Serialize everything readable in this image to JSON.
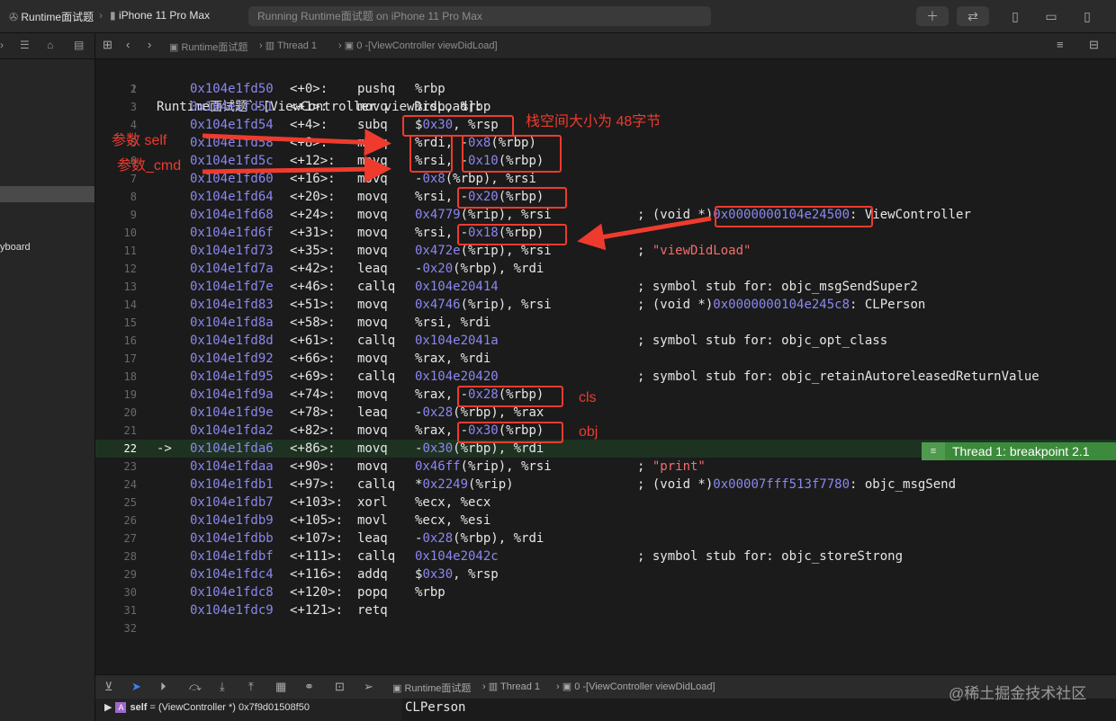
{
  "toolbar": {
    "scheme": "Runtime面试题",
    "device": "iPhone 11 Pro Max",
    "status": "Running Runtime面试题 on iPhone 11 Pro Max",
    "buttons": [
      "plus-icon",
      "swap-icon",
      "left-panel-icon",
      "bottom-panel-icon",
      "right-panel-icon"
    ]
  },
  "navigator": {
    "partial_label": "yboard"
  },
  "jumpbar": {
    "project": "Runtime面试题",
    "thread": "Thread 1",
    "frame": "0 -[ViewController viewDidLoad]"
  },
  "code": {
    "header_line": "1",
    "header": "Runtime面试题`-[ViewController viewDidLoad]:",
    "lines": [
      {
        "n": "2",
        "addr": "0x104e1fd50",
        "off": "<+0>:",
        "mn": "pushq",
        "ops": "%rbp",
        "cmt": ""
      },
      {
        "n": "3",
        "addr": "0x104e1fd51",
        "off": "<+1>:",
        "mn": "movq",
        "ops": "%rsp, %rbp",
        "cmt": ""
      },
      {
        "n": "4",
        "addr": "0x104e1fd54",
        "off": "<+4>:",
        "mn": "subq",
        "ops": "$0x30, %rsp",
        "cmt": ""
      },
      {
        "n": "5",
        "addr": "0x104e1fd58",
        "off": "<+8>:",
        "mn": "movq",
        "ops": "%rdi, -0x8(%rbp)",
        "cmt": ""
      },
      {
        "n": "6",
        "addr": "0x104e1fd5c",
        "off": "<+12>:",
        "mn": "movq",
        "ops": "%rsi, -0x10(%rbp)",
        "cmt": ""
      },
      {
        "n": "7",
        "addr": "0x104e1fd60",
        "off": "<+16>:",
        "mn": "movq",
        "ops": "-0x8(%rbp), %rsi",
        "cmt": ""
      },
      {
        "n": "8",
        "addr": "0x104e1fd64",
        "off": "<+20>:",
        "mn": "movq",
        "ops": "%rsi, -0x20(%rbp)",
        "cmt": ""
      },
      {
        "n": "9",
        "addr": "0x104e1fd68",
        "off": "<+24>:",
        "mn": "movq",
        "ops": "0x4779(%rip), %rsi",
        "cmt": "; (void *)0x0000000104e24500: ViewController"
      },
      {
        "n": "10",
        "addr": "0x104e1fd6f",
        "off": "<+31>:",
        "mn": "movq",
        "ops": "%rsi, -0x18(%rbp)",
        "cmt": ""
      },
      {
        "n": "11",
        "addr": "0x104e1fd73",
        "off": "<+35>:",
        "mn": "movq",
        "ops": "0x472e(%rip), %rsi",
        "cmt": "; \"viewDidLoad\""
      },
      {
        "n": "12",
        "addr": "0x104e1fd7a",
        "off": "<+42>:",
        "mn": "leaq",
        "ops": "-0x20(%rbp), %rdi",
        "cmt": ""
      },
      {
        "n": "13",
        "addr": "0x104e1fd7e",
        "off": "<+46>:",
        "mn": "callq",
        "ops": "0x104e20414",
        "cmt": "; symbol stub for: objc_msgSendSuper2"
      },
      {
        "n": "14",
        "addr": "0x104e1fd83",
        "off": "<+51>:",
        "mn": "movq",
        "ops": "0x4746(%rip), %rsi",
        "cmt": "; (void *)0x0000000104e245c8: CLPerson"
      },
      {
        "n": "15",
        "addr": "0x104e1fd8a",
        "off": "<+58>:",
        "mn": "movq",
        "ops": "%rsi, %rdi",
        "cmt": ""
      },
      {
        "n": "16",
        "addr": "0x104e1fd8d",
        "off": "<+61>:",
        "mn": "callq",
        "ops": "0x104e2041a",
        "cmt": "; symbol stub for: objc_opt_class"
      },
      {
        "n": "17",
        "addr": "0x104e1fd92",
        "off": "<+66>:",
        "mn": "movq",
        "ops": "%rax, %rdi",
        "cmt": ""
      },
      {
        "n": "18",
        "addr": "0x104e1fd95",
        "off": "<+69>:",
        "mn": "callq",
        "ops": "0x104e20420",
        "cmt": "; symbol stub for: objc_retainAutoreleasedReturnValue"
      },
      {
        "n": "19",
        "addr": "0x104e1fd9a",
        "off": "<+74>:",
        "mn": "movq",
        "ops": "%rax, -0x28(%rbp)",
        "cmt": ""
      },
      {
        "n": "20",
        "addr": "0x104e1fd9e",
        "off": "<+78>:",
        "mn": "leaq",
        "ops": "-0x28(%rbp), %rax",
        "cmt": ""
      },
      {
        "n": "21",
        "addr": "0x104e1fda2",
        "off": "<+82>:",
        "mn": "movq",
        "ops": "%rax, -0x30(%rbp)",
        "cmt": ""
      },
      {
        "n": "22",
        "addr": "0x104e1fda6",
        "off": "<+86>:",
        "mn": "movq",
        "ops": "-0x30(%rbp), %rdi",
        "cmt": "",
        "current": true,
        "arrow": "->"
      },
      {
        "n": "23",
        "addr": "0x104e1fdaa",
        "off": "<+90>:",
        "mn": "movq",
        "ops": "0x46ff(%rip), %rsi",
        "cmt": "; \"print\""
      },
      {
        "n": "24",
        "addr": "0x104e1fdb1",
        "off": "<+97>:",
        "mn": "callq",
        "ops": "*0x2249(%rip)",
        "cmt": "; (void *)0x00007fff513f7780: objc_msgSend"
      },
      {
        "n": "25",
        "addr": "0x104e1fdb7",
        "off": "<+103>:",
        "mn": "xorl",
        "ops": "%ecx, %ecx",
        "cmt": ""
      },
      {
        "n": "26",
        "addr": "0x104e1fdb9",
        "off": "<+105>:",
        "mn": "movl",
        "ops": "%ecx, %esi",
        "cmt": ""
      },
      {
        "n": "27",
        "addr": "0x104e1fdbb",
        "off": "<+107>:",
        "mn": "leaq",
        "ops": "-0x28(%rbp), %rdi",
        "cmt": ""
      },
      {
        "n": "28",
        "addr": "0x104e1fdbf",
        "off": "<+111>:",
        "mn": "callq",
        "ops": "0x104e2042c",
        "cmt": "; symbol stub for: objc_storeStrong"
      },
      {
        "n": "29",
        "addr": "0x104e1fdc4",
        "off": "<+116>:",
        "mn": "addq",
        "ops": "$0x30, %rsp",
        "cmt": ""
      },
      {
        "n": "30",
        "addr": "0x104e1fdc8",
        "off": "<+120>:",
        "mn": "popq",
        "ops": "%rbp",
        "cmt": ""
      },
      {
        "n": "31",
        "addr": "0x104e1fdc9",
        "off": "<+121>:",
        "mn": "retq",
        "ops": "",
        "cmt": ""
      },
      {
        "n": "32",
        "addr": "",
        "off": "",
        "mn": "",
        "ops": "",
        "cmt": ""
      }
    ],
    "breakpoint_badge": "Thread 1: breakpoint 2.1"
  },
  "annotations": {
    "stack_size": "栈空间大小为 48字节",
    "param_self": "参数 self",
    "param_cmd": "参数_cmd",
    "cls": "cls",
    "obj": "obj"
  },
  "debugbar": {
    "project": "Runtime面试题",
    "thread": "Thread 1",
    "frame": "0 -[ViewController viewDidLoad]"
  },
  "variables": {
    "row1_name": "self",
    "row1_value": "= (ViewController *) 0x7f9d01508f50"
  },
  "console": {
    "output": "CLPerson"
  },
  "watermark": "@稀土掘金技术社区",
  "colors": {
    "annotation": "#ee3b2e",
    "address": "#8b87f0",
    "string": "#f26d6d",
    "breakpoint": "#3c8a3c"
  }
}
